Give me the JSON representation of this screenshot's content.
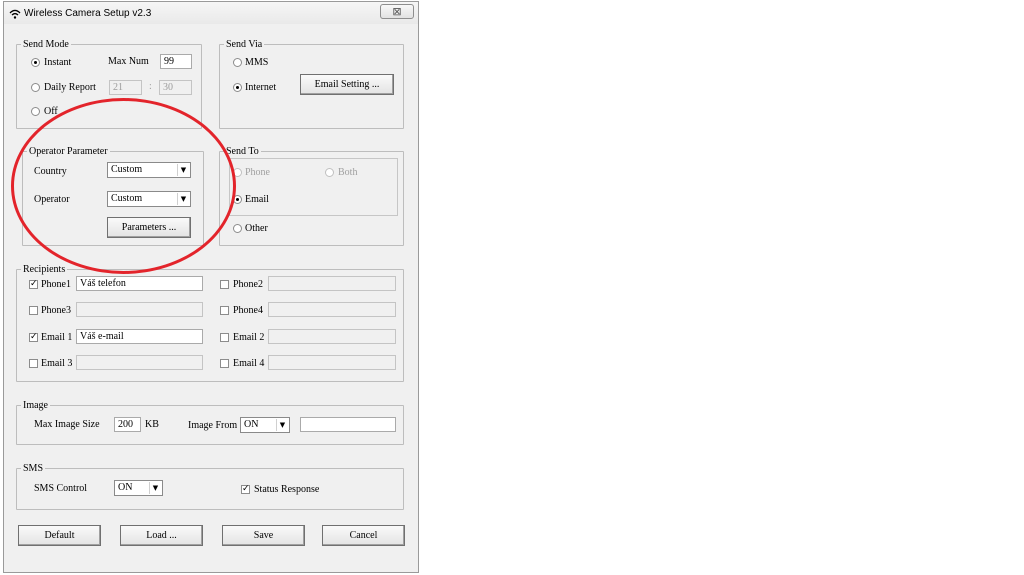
{
  "window": {
    "title": "Wireless Camera Setup  v2.3",
    "close_glyph": "⊠"
  },
  "send_mode": {
    "legend": "Send Mode",
    "instant_label": "Instant",
    "max_num_label": "Max Num",
    "max_num_value": "99",
    "daily_report_label": "Daily Report",
    "daily_from": "21",
    "daily_sep": ":",
    "daily_to": "30",
    "off_label": "Off"
  },
  "send_via": {
    "legend": "Send Via",
    "mms_label": "MMS",
    "internet_label": "Internet",
    "email_setting_button": "Email Setting ..."
  },
  "operator_parameter": {
    "legend": "Operator Parameter",
    "country_label": "Country",
    "country_value": "Custom",
    "operator_label": "Operator",
    "operator_value": "Custom",
    "parameters_button": "Parameters ..."
  },
  "send_to": {
    "legend": "Send To",
    "phone_label": "Phone",
    "both_label": "Both",
    "email_label": "Email",
    "other_label": "Other"
  },
  "recipients": {
    "legend": "Recipients",
    "phone1_label": "Phone1",
    "phone1_value": "Váš telefon",
    "phone2_label": "Phone2",
    "phone2_value": "",
    "phone3_label": "Phone3",
    "phone3_value": "",
    "phone4_label": "Phone4",
    "phone4_value": "",
    "email1_label": "Email 1",
    "email1_value": "Váš e-mail",
    "email2_label": "Email 2",
    "email2_value": "",
    "email3_label": "Email 3",
    "email3_value": "",
    "email4_label": "Email 4",
    "email4_value": ""
  },
  "image": {
    "legend": "Image",
    "max_size_label": "Max Image Size",
    "max_size_value": "200",
    "max_size_unit": "KB",
    "image_from_label": "Image From",
    "image_from_value": "ON",
    "image_from_extra": ""
  },
  "sms": {
    "legend": "SMS",
    "control_label": "SMS Control",
    "control_value": "ON",
    "status_response_label": "Status Response"
  },
  "buttons": {
    "default": "Default",
    "load": "Load ...",
    "save": "Save",
    "cancel": "Cancel"
  },
  "icons": {
    "arrow": "▼",
    "app": "wifi-icon"
  },
  "annotation": {
    "color": "#e3242b"
  }
}
